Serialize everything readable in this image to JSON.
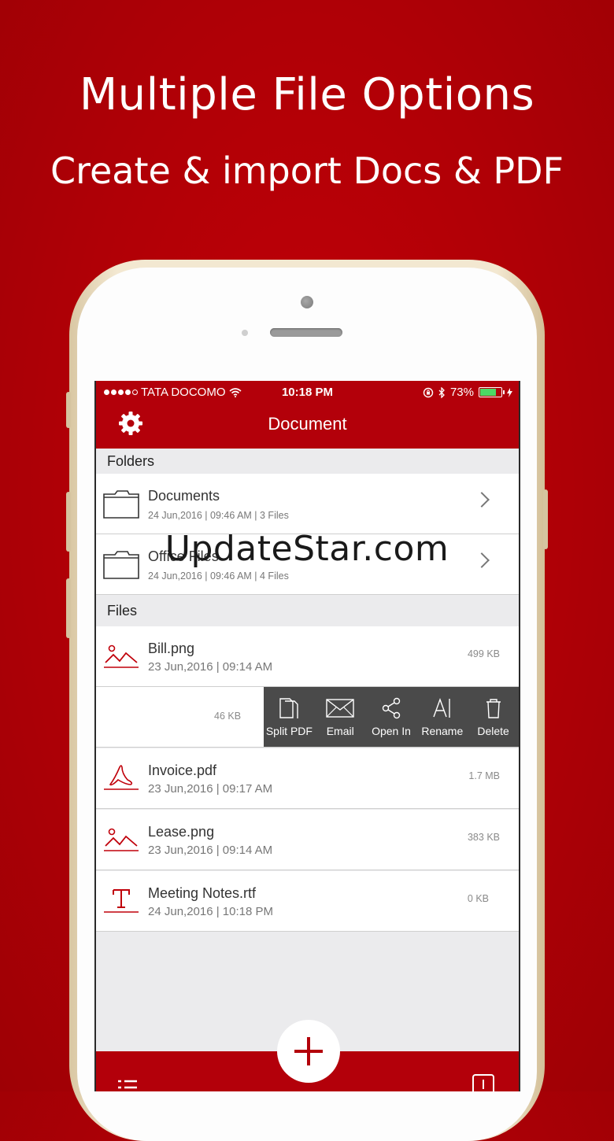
{
  "promo": {
    "headline": "Multiple File Options",
    "subheadline": "Create & import Docs & PDF"
  },
  "status": {
    "carrier": "TATA DOCOMO",
    "time": "10:18 PM",
    "battery": "73%",
    "battery_level": 0.73
  },
  "nav": {
    "title": "Document"
  },
  "folders_header": "Folders",
  "folders": [
    {
      "name": "Documents",
      "meta": "24 Jun,2016 | 09:46 AM | 3 Files"
    },
    {
      "name": "Office Files",
      "meta": "24 Jun,2016 | 09:46 AM | 4 Files"
    }
  ],
  "files_header": "Files",
  "files": [
    {
      "name": "Bill.png",
      "meta": "23 Jun,2016 | 09:14 AM",
      "size": "499 KB",
      "icon": "image-icon"
    },
    {
      "name": "Invoice.pdf",
      "meta": "23 Jun,2016 | 09:17 AM",
      "size": "1.7 MB",
      "icon": "pdf-icon"
    },
    {
      "name": "Lease.png",
      "meta": "23 Jun,2016 | 09:14 AM",
      "size": "383 KB",
      "icon": "image-icon"
    },
    {
      "name": "Meeting Notes.rtf",
      "meta": "24 Jun,2016 | 10:18 PM",
      "size": "0 KB",
      "icon": "text-icon"
    }
  ],
  "swiped_row": {
    "size": "46 KB",
    "actions": [
      "Split PDF",
      "Email",
      "Open In",
      "Rename",
      "Delete"
    ]
  },
  "watermark": "UpdateStar.com",
  "colors": {
    "brand": "#b3000a",
    "background": "#b00006",
    "action_bar": "#4a4a4a"
  }
}
